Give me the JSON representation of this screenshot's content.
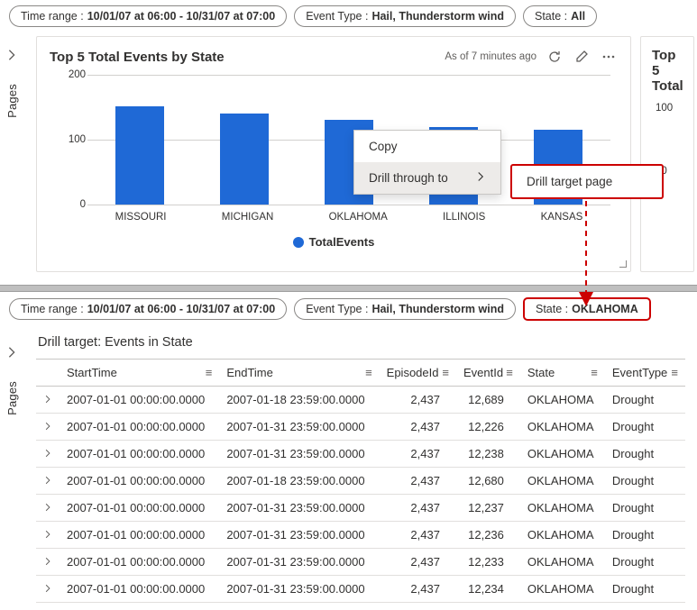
{
  "top": {
    "filters": {
      "time_label": "Time range :",
      "time_value": "10/01/07 at 06:00 - 10/31/07 at 07:00",
      "event_label": "Event Type :",
      "event_value": "Hail, Thunderstorm wind",
      "state_label": "State :",
      "state_value": "All"
    },
    "pages_label": "Pages",
    "tile": {
      "title": "Top 5 Total Events by State",
      "as_of": "As of 7 minutes ago",
      "legend": "TotalEvents"
    },
    "side_tile_title": "Top 5 Total",
    "context_menu": {
      "copy": "Copy",
      "drill": "Drill through to",
      "target": "Drill target page"
    }
  },
  "chart_data": {
    "type": "bar",
    "categories": [
      "MISSOURI",
      "MICHIGAN",
      "OKLAHOMA",
      "ILLINOIS",
      "KANSAS"
    ],
    "values": [
      152,
      140,
      130,
      120,
      115
    ],
    "title": "Top 5 Total Events by State",
    "xlabel": "",
    "ylabel": "",
    "ylim": [
      0,
      200
    ],
    "y_ticks": [
      0,
      100,
      200
    ],
    "side_ylim": [
      0,
      100
    ],
    "side_y_ticks": [
      50,
      100
    ]
  },
  "bottom": {
    "filters": {
      "time_label": "Time range :",
      "time_value": "10/01/07 at 06:00 - 10/31/07 at 07:00",
      "event_label": "Event Type :",
      "event_value": "Hail, Thunderstorm wind",
      "state_label": "State :",
      "state_value": "OKLAHOMA"
    },
    "pages_label": "Pages",
    "title": "Drill target: Events in State",
    "columns": [
      "StartTime",
      "EndTime",
      "EpisodeId",
      "EventId",
      "State",
      "EventType"
    ],
    "rows": [
      {
        "start": "2007-01-01 00:00:00.0000",
        "end": "2007-01-18 23:59:00.0000",
        "ep": "2,437",
        "ev": "12,689",
        "state": "OKLAHOMA",
        "type": "Drought"
      },
      {
        "start": "2007-01-01 00:00:00.0000",
        "end": "2007-01-31 23:59:00.0000",
        "ep": "2,437",
        "ev": "12,226",
        "state": "OKLAHOMA",
        "type": "Drought"
      },
      {
        "start": "2007-01-01 00:00:00.0000",
        "end": "2007-01-31 23:59:00.0000",
        "ep": "2,437",
        "ev": "12,238",
        "state": "OKLAHOMA",
        "type": "Drought"
      },
      {
        "start": "2007-01-01 00:00:00.0000",
        "end": "2007-01-18 23:59:00.0000",
        "ep": "2,437",
        "ev": "12,680",
        "state": "OKLAHOMA",
        "type": "Drought"
      },
      {
        "start": "2007-01-01 00:00:00.0000",
        "end": "2007-01-31 23:59:00.0000",
        "ep": "2,437",
        "ev": "12,237",
        "state": "OKLAHOMA",
        "type": "Drought"
      },
      {
        "start": "2007-01-01 00:00:00.0000",
        "end": "2007-01-31 23:59:00.0000",
        "ep": "2,437",
        "ev": "12,236",
        "state": "OKLAHOMA",
        "type": "Drought"
      },
      {
        "start": "2007-01-01 00:00:00.0000",
        "end": "2007-01-31 23:59:00.0000",
        "ep": "2,437",
        "ev": "12,233",
        "state": "OKLAHOMA",
        "type": "Drought"
      },
      {
        "start": "2007-01-01 00:00:00.0000",
        "end": "2007-01-31 23:59:00.0000",
        "ep": "2,437",
        "ev": "12,234",
        "state": "OKLAHOMA",
        "type": "Drought"
      }
    ]
  }
}
